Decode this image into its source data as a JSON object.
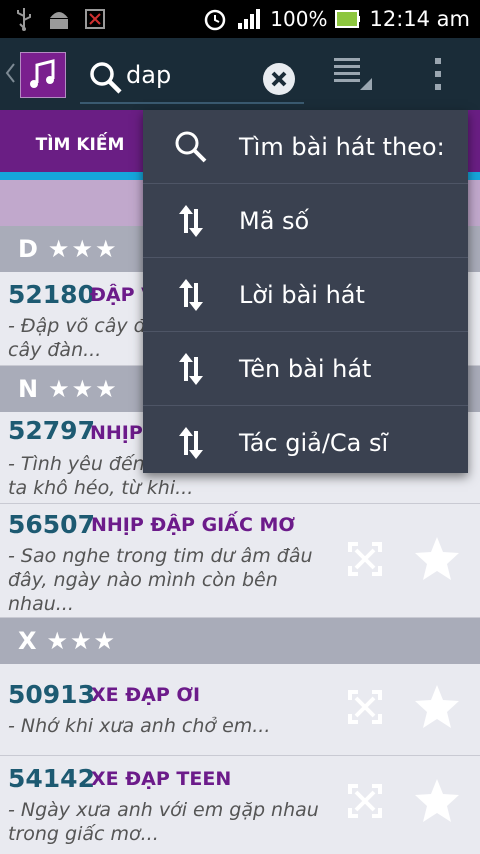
{
  "status": {
    "battery": "100%",
    "time": "12:14 am"
  },
  "search": {
    "query": "dap"
  },
  "tabs": {
    "search_label": "TÌM KIẾM"
  },
  "menu": {
    "items": [
      {
        "label": "Tìm bài hát theo:",
        "icon": "search-icon"
      },
      {
        "label": "Mã số",
        "icon": "sort-icon"
      },
      {
        "label": "Lời bài hát",
        "icon": "sort-icon"
      },
      {
        "label": "Tên bài hát",
        "icon": "sort-icon"
      },
      {
        "label": "Tác giả/Ca sĩ",
        "icon": "sort-icon"
      }
    ]
  },
  "sections": [
    {
      "letter": "D",
      "stars": "★★★"
    },
    {
      "letter": "N",
      "stars": "★★★"
    },
    {
      "letter": "X",
      "stars": "★★★"
    }
  ],
  "songs": [
    {
      "code": "52180",
      "title": "ĐẬP V",
      "lyric_1": "- Đập võ cây đ",
      "lyric_2": "cây đàn..."
    },
    {
      "code": "52797",
      "title": "NHỊP",
      "lyric_1": "- Tình yêu đến",
      "lyric_2": "ta khô héo, từ khi..."
    },
    {
      "code": "56507",
      "title": "NHỊP ĐẬP GIẤC MƠ",
      "lyric_1": "- Sao nghe trong tim dư âm đâu",
      "lyric_2": "đây, ngày nào mình còn bên",
      "lyric_3": "nhau..."
    },
    {
      "code": "50913",
      "title": "XE ĐẠP ƠI",
      "lyric_1": "- Nhớ khi xưa anh chở em..."
    },
    {
      "code": "54142",
      "title": "XE ĐẠP TEEN",
      "lyric_1": "- Ngày xưa anh với em gặp nhau",
      "lyric_2": "trong giấc mơ..."
    }
  ]
}
